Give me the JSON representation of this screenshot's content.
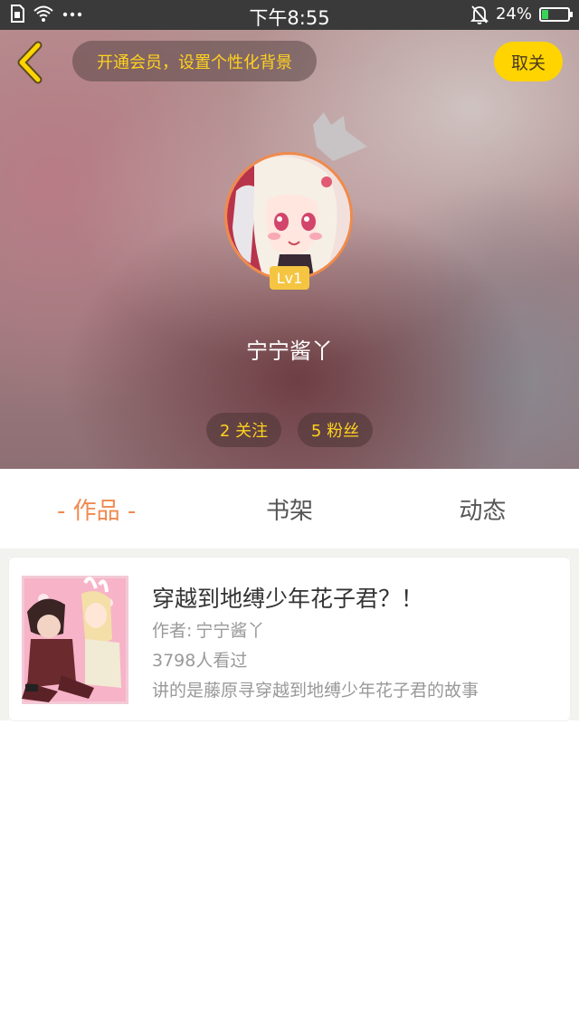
{
  "status_bar": {
    "time": "下午8:55",
    "battery_percent": "24%",
    "battery_level": 0.24,
    "left_icons": [
      "sim-icon",
      "wifi-icon",
      "more-dots-icon"
    ],
    "right_icons": [
      "bell-muted-icon",
      "battery-icon"
    ]
  },
  "header": {
    "vip_banner": "开通会员，设置个性化背景",
    "unfollow_label": "取关"
  },
  "profile": {
    "level": "Lv1",
    "username": "宁宁酱丫",
    "following": "2 关注",
    "fans": "5 粉丝"
  },
  "tabs": [
    {
      "label": "- 作品 -",
      "active": true
    },
    {
      "label": "书架",
      "active": false
    },
    {
      "label": "动态",
      "active": false
    }
  ],
  "works": [
    {
      "title": "穿越到地缚少年花子君？！",
      "author_prefix": "作者:",
      "author": "宁宁酱丫",
      "views": "3798人看过",
      "description": "讲的是藤原寻穿越到地缚少年花子君的故事"
    }
  ],
  "colors": {
    "accent_orange": "#f0894f",
    "vip_yellow": "#ffd21f",
    "button_yellow": "#ffd400",
    "level_gold": "#f5c542"
  }
}
